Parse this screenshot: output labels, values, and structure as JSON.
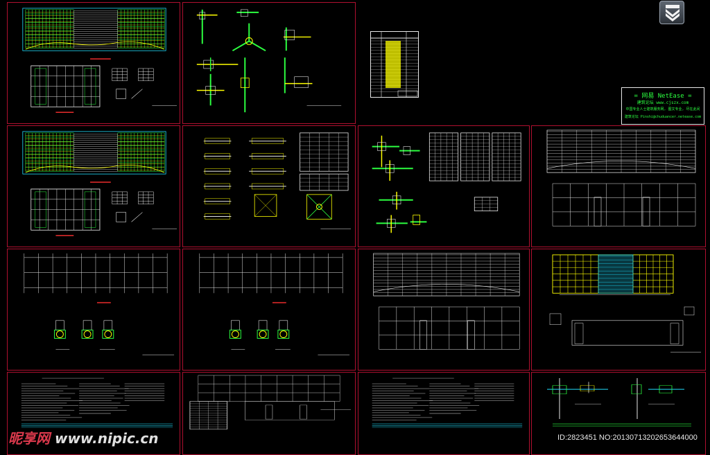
{
  "stamp": {
    "title": "= 网易 NetEase =",
    "subtitle": "建筑论坛  www.cjszx.com",
    "line3": "中国专业人士建筑服务网, 图文专业, 尽在此间",
    "line4": "建筑论坛  Pinshi@chuduancer.netease.com"
  },
  "watermark": {
    "brand": "昵享网",
    "url": "www.nipic.cn"
  },
  "image_id": "ID:2823451 NO:20130713202653644000",
  "download_icon": "double-chevron-down-icon",
  "colors": {
    "sheet_border": "#b01030",
    "cad_green": "#2cff40",
    "cad_yellow": "#ffff00",
    "cad_cyan": "#20e0ff",
    "cad_white": "#e8e8e8"
  }
}
